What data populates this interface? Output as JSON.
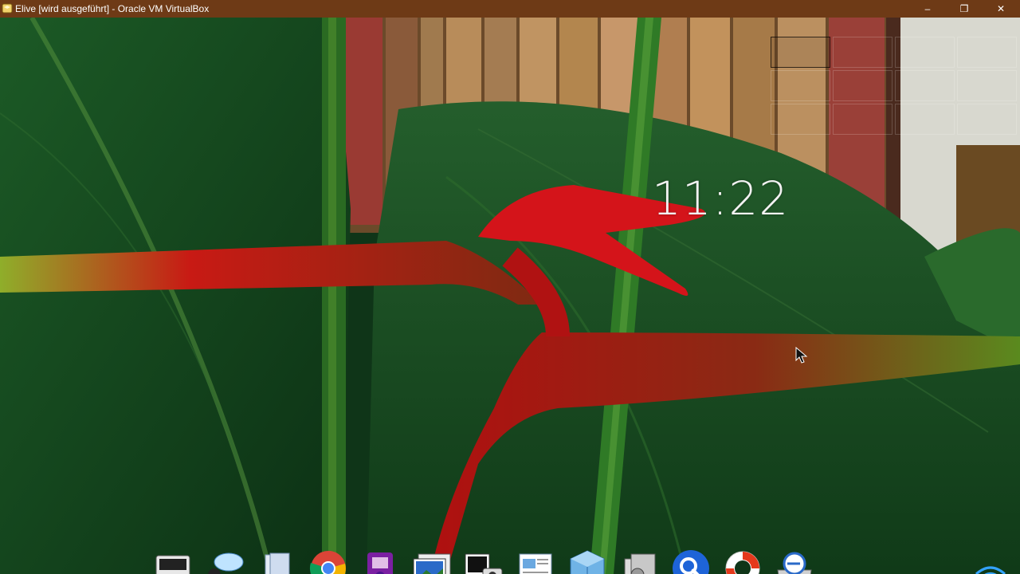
{
  "window": {
    "title": "Elive [wird ausgeführt] - Oracle VM VirtualBox",
    "minimize_glyph": "–",
    "maximize_glyph": "❐",
    "close_glyph": "✕"
  },
  "desktop": {
    "clock": "11:22",
    "workspace_pager": {
      "columns": 4,
      "rows": 3,
      "active_index": 0
    },
    "colors": {
      "titlebar": "#6e3a16",
      "leaf_green": "#1f5a2a",
      "flower_red": "#d4141a",
      "clock_text": "#f2f2f2"
    }
  },
  "dock": {
    "items": [
      {
        "name": "computer-icon"
      },
      {
        "name": "chat-icon"
      },
      {
        "name": "files-icon"
      },
      {
        "name": "chrome-icon"
      },
      {
        "name": "media-player-icon"
      },
      {
        "name": "image-viewer-icon"
      },
      {
        "name": "screenshot-icon"
      },
      {
        "name": "document-icon"
      },
      {
        "name": "virtualbox-icon"
      },
      {
        "name": "settings-icon"
      },
      {
        "name": "search-icon"
      },
      {
        "name": "help-lifebuoy-icon"
      },
      {
        "name": "disk-icon"
      }
    ]
  },
  "tray": {
    "wifi": "wifi-icon"
  }
}
